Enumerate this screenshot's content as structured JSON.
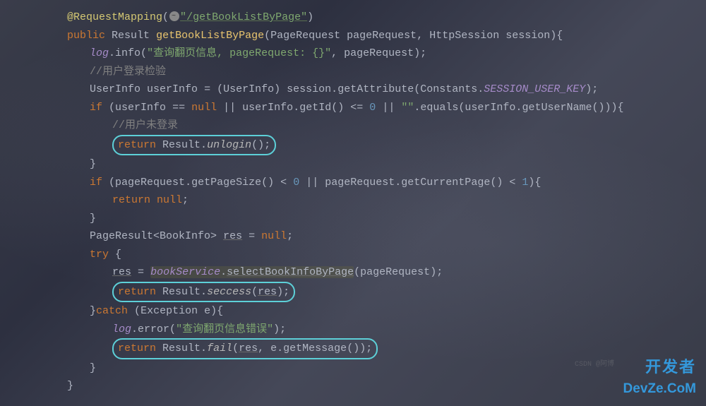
{
  "code": {
    "l1": {
      "annotation": "@RequestMapping",
      "path": "/getBookListByPage"
    },
    "l2": {
      "kw1": "public",
      "type": "Result",
      "method": "getBookListByPage",
      "p1type": "PageRequest",
      "p1": "pageRequest",
      "p2type": "HttpSession",
      "p2": "session"
    },
    "l3": {
      "obj": "log",
      "call": "info",
      "str": "\"查询翻页信息, pageRequest: {}\"",
      "arg": "pageRequest"
    },
    "l4": {
      "comment": "//用户登录检验"
    },
    "l5": {
      "type": "UserInfo",
      "var": "userInfo",
      "cast": "UserInfo",
      "obj": "session",
      "call": "getAttribute",
      "cls": "Constants",
      "const": "SESSION_USER_KEY"
    },
    "l6": {
      "kw": "if",
      "v1": "userInfo",
      "op1": "==",
      "n1": "null",
      "op2": "||",
      "v2": "userInfo",
      "c2": "getId",
      "op3": "<=",
      "num": "0",
      "op4": "||",
      "str": "\"\"",
      "c3": "equals",
      "v3": "userInfo",
      "c4": "getUserName"
    },
    "l7": {
      "comment": "//用户未登录"
    },
    "l8": {
      "kw": "return",
      "cls": "Result",
      "call": "unlogin"
    },
    "l9": {
      "brace": "}"
    },
    "l10": {
      "kw": "if",
      "v1": "pageRequest",
      "c1": "getPageSize",
      "op1": "<",
      "n1": "0",
      "op2": "||",
      "v2": "pageRequest",
      "c2": "getCurrentPage",
      "op3": "<",
      "n2": "1"
    },
    "l11": {
      "kw": "return",
      "val": "null"
    },
    "l12": {
      "brace": "}"
    },
    "l13": {
      "type": "PageResult",
      "generic": "BookInfo",
      "var": "res",
      "val": "null"
    },
    "l14": {
      "kw": "try"
    },
    "l15": {
      "var": "res",
      "obj": "bookService",
      "call": "selectBookInfoByPage",
      "arg": "pageRequest"
    },
    "l16": {
      "kw": "return",
      "cls": "Result",
      "call": "seccess",
      "arg": "res"
    },
    "l17": {
      "kw": "catch",
      "type": "Exception",
      "var": "e"
    },
    "l18": {
      "obj": "log",
      "call": "error",
      "str": "\"查询翻页信息错误\""
    },
    "l19": {
      "kw": "return",
      "cls": "Result",
      "call": "fail",
      "arg1": "res",
      "arg2obj": "e",
      "arg2call": "getMessage"
    },
    "l20": {
      "brace": "}"
    },
    "l21": {
      "brace": "}"
    }
  },
  "watermark": {
    "cn": "开发者",
    "en": "DevZe.CoM"
  },
  "csdn": "CSDN @阿博"
}
